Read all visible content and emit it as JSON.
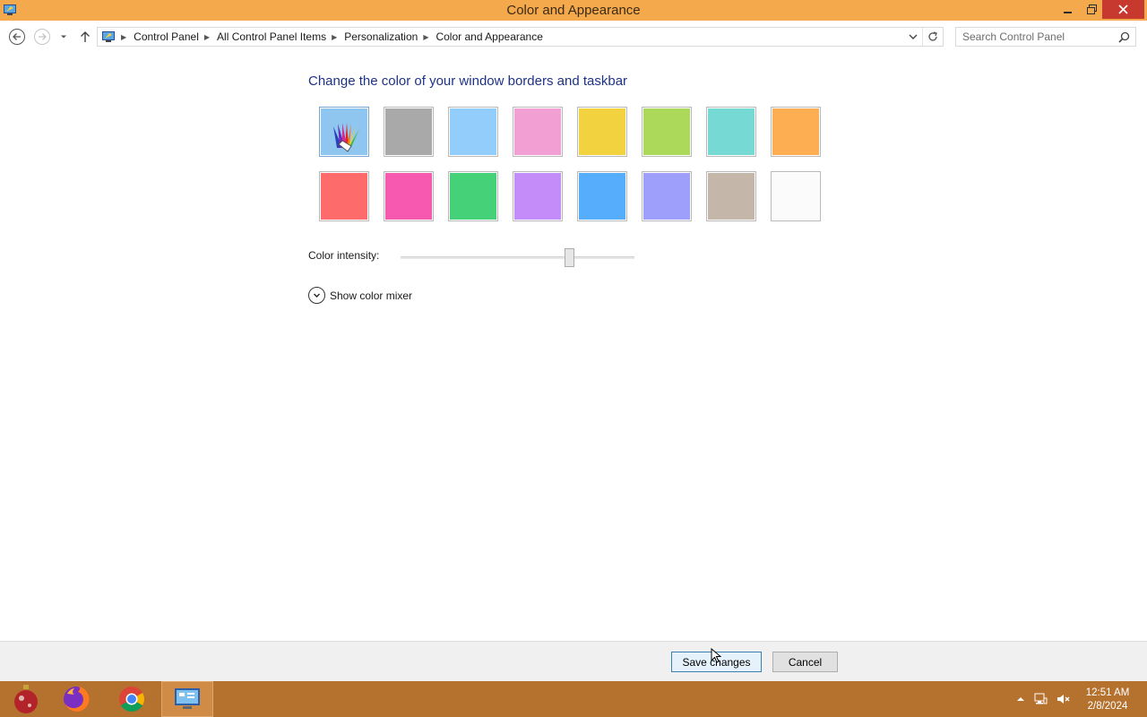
{
  "window": {
    "title": "Color and Appearance",
    "controls": [
      "minimize-icon",
      "restore-icon",
      "close-icon"
    ]
  },
  "navigation": {
    "breadcrumbs": [
      "Control Panel",
      "All Control Panel Items",
      "Personalization",
      "Color and Appearance"
    ],
    "search_placeholder": "Search Control Panel"
  },
  "content": {
    "heading": "Change the color of your window borders and taskbar",
    "swatches": [
      {
        "name": "automatic",
        "color": "#8fc6f0",
        "selected": true
      },
      {
        "name": "gray",
        "color": "#a9a9a9"
      },
      {
        "name": "sky-blue",
        "color": "#92cdfb"
      },
      {
        "name": "pink",
        "color": "#f29fd4"
      },
      {
        "name": "yellow",
        "color": "#f2d33f"
      },
      {
        "name": "lime",
        "color": "#add95b"
      },
      {
        "name": "teal",
        "color": "#76d9d4"
      },
      {
        "name": "orange",
        "color": "#fdad52"
      },
      {
        "name": "red",
        "color": "#fd6b6b"
      },
      {
        "name": "magenta",
        "color": "#f859b0"
      },
      {
        "name": "green",
        "color": "#45d177"
      },
      {
        "name": "violet",
        "color": "#c48cf9"
      },
      {
        "name": "blue",
        "color": "#55adfb"
      },
      {
        "name": "periwinkle",
        "color": "#9e9efb"
      },
      {
        "name": "taupe",
        "color": "#c4b6a9"
      },
      {
        "name": "white",
        "color": "#fbfbfb"
      }
    ],
    "intensity_label": "Color intensity:",
    "intensity_value": 0.72,
    "mixer_label": "Show color mixer"
  },
  "buttons": {
    "save": "Save changes",
    "cancel": "Cancel"
  },
  "taskbar": {
    "apps": [
      "ornament-icon",
      "firefox-icon",
      "chrome-icon",
      "control-panel-icon"
    ],
    "tray": [
      "show-hidden-icons",
      "network-icon",
      "volume-muted-icon"
    ],
    "time": "12:51 AM",
    "date": "2/8/2024"
  }
}
